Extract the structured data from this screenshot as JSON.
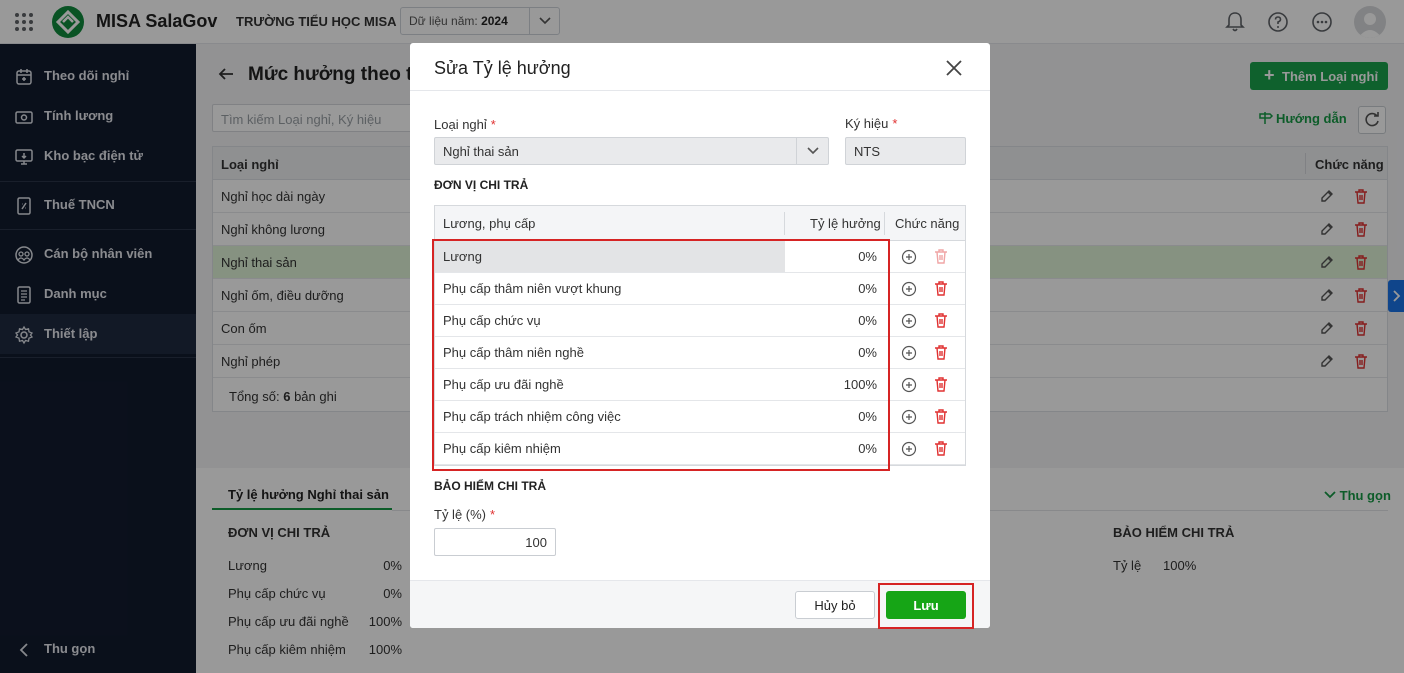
{
  "topbar": {
    "app_name": "MISA SalaGov",
    "school": "TRƯỜNG TIỂU HỌC MISA",
    "year_label": "Dữ liệu năm:",
    "year_value": "2024"
  },
  "sidebar": {
    "items": [
      {
        "label": "Theo dõi nghỉ",
        "icon": "calendar-icon"
      },
      {
        "label": "Tính lương",
        "icon": "money-icon"
      },
      {
        "label": "Kho bạc điện tử",
        "icon": "monitor-icon"
      },
      {
        "label": "Thuế TNCN",
        "icon": "tax-document-icon"
      },
      {
        "label": "Cán bộ nhân viên",
        "icon": "people-icon"
      },
      {
        "label": "Danh mục",
        "icon": "list-document-icon"
      },
      {
        "label": "Thiết lập",
        "icon": "gear-icon"
      }
    ],
    "collapse_label": "Thu gọn"
  },
  "page": {
    "title": "Mức hưởng theo tỉ",
    "search_placeholder": "Tìm kiếm Loại nghỉ, Ký hiệu",
    "add_button": "Thêm Loại nghỉ",
    "guide_link": "Hướng dẫn",
    "table": {
      "col_name": "Loại nghỉ",
      "col_actions": "Chức năng",
      "rows": [
        "Nghỉ học dài ngày",
        "Nghỉ không lương",
        "Nghỉ thai sản",
        "Nghỉ ốm, điều dưỡng",
        "Con ốm",
        "Nghỉ phép"
      ],
      "selected_row": "Nghỉ thai sản",
      "total_prefix": "Tổng số:",
      "total_count": "6",
      "total_suffix": "bản ghi"
    }
  },
  "bottom": {
    "tab": "Tỷ lệ hưởng Nghỉ thai sản",
    "collapse": "Thu gọn",
    "unit_title": "ĐƠN VỊ CHI TRẢ",
    "rows": [
      {
        "name": "Lương",
        "value": "0%"
      },
      {
        "name": "Phụ cấp chức vụ",
        "value": "0%"
      },
      {
        "name": "Phụ cấp ưu đãi nghề",
        "value": "100%"
      },
      {
        "name": "Phụ cấp kiêm nhiệm",
        "value": "100%"
      }
    ],
    "insurance_title": "BẢO HIỂM CHI TRẢ",
    "rate_label": "Tỷ lệ",
    "rate_value": "100%"
  },
  "modal": {
    "title": "Sửa Tỷ lệ hưởng",
    "leave_type_label": "Loại nghỉ",
    "leave_type_value": "Nghỉ thai sản",
    "code_label": "Ký hiệu",
    "code_value": "NTS",
    "required_mark": "*",
    "unit_section": "ĐƠN VỊ CHI TRẢ",
    "table": {
      "col_name": "Lương, phụ cấp",
      "col_rate": "Tỷ lệ hưởng",
      "col_actions": "Chức năng",
      "rows": [
        {
          "name": "Lương",
          "rate": "0%"
        },
        {
          "name": "Phụ cấp thâm niên vượt khung",
          "rate": "0%"
        },
        {
          "name": "Phụ cấp chức vụ",
          "rate": "0%"
        },
        {
          "name": "Phụ cấp thâm niên nghề",
          "rate": "0%"
        },
        {
          "name": "Phụ cấp ưu đãi nghề",
          "rate": "100%"
        },
        {
          "name": "Phụ cấp trách nhiệm công việc",
          "rate": "0%"
        },
        {
          "name": "Phụ cấp kiêm nhiệm",
          "rate": "0%"
        }
      ]
    },
    "insurance_section": "BẢO HIỂM CHI TRẢ",
    "rate_label": "Tỷ lệ (%)",
    "rate_value": "100",
    "cancel_button": "Hủy bỏ",
    "save_button": "Lưu"
  },
  "colors": {
    "brand_green": "#1aa24b",
    "sidebar_bg": "#121b2e",
    "highlight_red": "#d62424",
    "save_green": "#16a516"
  }
}
